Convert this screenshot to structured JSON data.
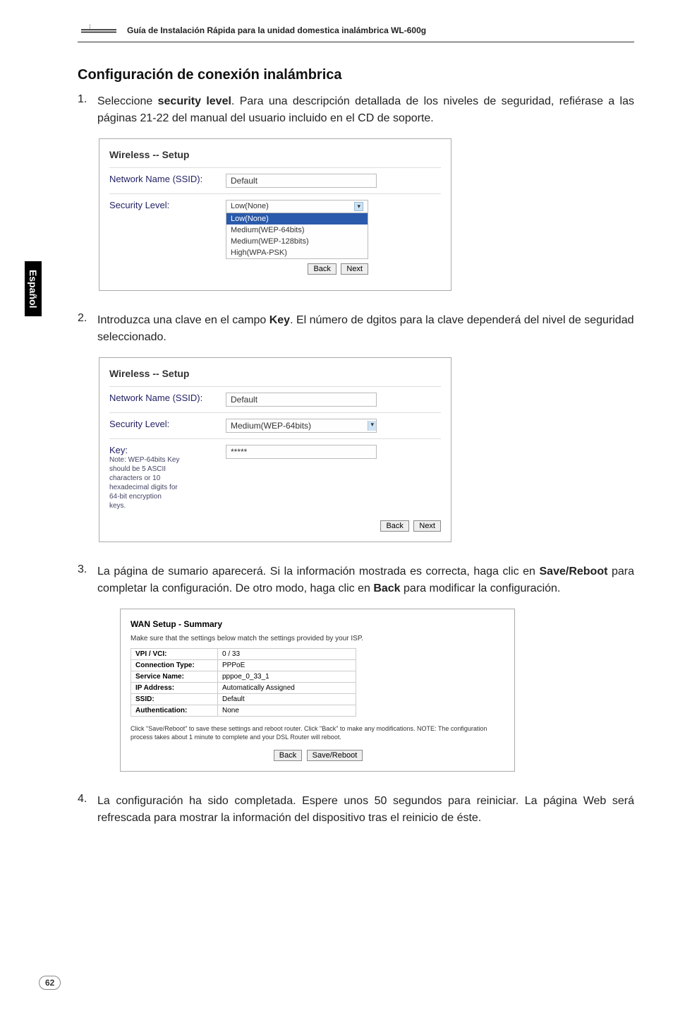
{
  "header": {
    "title": "Guía de Instalación Rápida para la unidad domestica inalámbrica WL-600g"
  },
  "sideTab": "Español",
  "section": {
    "title": "Configuración de conexión inalámbrica"
  },
  "step1": {
    "number": "1.",
    "text_prefix": "Seleccione ",
    "text_bold": "security level",
    "text_suffix": ". Para una descripción detallada de los niveles de seguridad, refiérase a las páginas 21-22 del manual del usuario incluido en el CD de soporte."
  },
  "screenshot1": {
    "title": "Wireless -- Setup",
    "rows": {
      "ssidLabel": "Network Name (SSID):",
      "ssidValue": "Default",
      "securityLabel": "Security Level:",
      "dropdownSelected": "Low(None)",
      "dropdownHighlighted": "Low(None)",
      "dropdownItem1": "Medium(WEP-64bits)",
      "dropdownItem2": "Medium(WEP-128bits)",
      "dropdownItem3": "High(WPA-PSK)"
    },
    "backBtn": "Back",
    "nextBtn": "Next"
  },
  "step2": {
    "number": "2.",
    "text_prefix": "Introduzca una clave en el campo ",
    "text_bold": "Key",
    "text_suffix": ". El número de dgitos para la clave dependerá del nivel de seguridad seleccionado."
  },
  "screenshot2": {
    "title": "Wireless -- Setup",
    "ssidLabel": "Network Name (SSID):",
    "ssidValue": "Default",
    "securityLabel": "Security Level:",
    "securityValue": "Medium(WEP-64bits)",
    "keyLabel": "Key:",
    "keyNote": "Note: WEP-64bits Key should be 5 ASCII characters or 10 hexadecimal digits for 64-bit encryption keys.",
    "keyValue": "*****",
    "backBtn": "Back",
    "nextBtn": "Next"
  },
  "step3": {
    "number": "3.",
    "text_prefix": "La página de sumario aparecerá. Si la información mostrada es correcta, haga clic en ",
    "text_bold1": "Save/Reboot",
    "text_mid": " para completar la configuración. De otro modo, haga clic en ",
    "text_bold2": "Back",
    "text_suffix": " para modificar la configuración."
  },
  "screenshot3": {
    "title": "WAN Setup - Summary",
    "desc": "Make sure that the settings below match the settings provided by your ISP.",
    "rows": [
      {
        "label": "VPI / VCI:",
        "value": "0 / 33"
      },
      {
        "label": "Connection Type:",
        "value": "PPPoE"
      },
      {
        "label": "Service Name:",
        "value": "pppoe_0_33_1"
      },
      {
        "label": "IP Address:",
        "value": "Automatically Assigned"
      },
      {
        "label": "SSID:",
        "value": "Default"
      },
      {
        "label": "Authentication:",
        "value": "None"
      }
    ],
    "note": "Click \"Save/Reboot\" to save these settings and reboot router. Click \"Back\" to make any modifications. NOTE: The configuration process takes about 1 minute to complete and your DSL Router will reboot.",
    "backBtn": "Back",
    "saveBtn": "Save/Reboot"
  },
  "step4": {
    "number": "4.",
    "text": "La configuración ha sido completada. Espere unos 50 segundos para reiniciar. La página Web será refrescada para mostrar la información del dispositivo tras el reinicio de éste."
  },
  "pageNumber": "62"
}
